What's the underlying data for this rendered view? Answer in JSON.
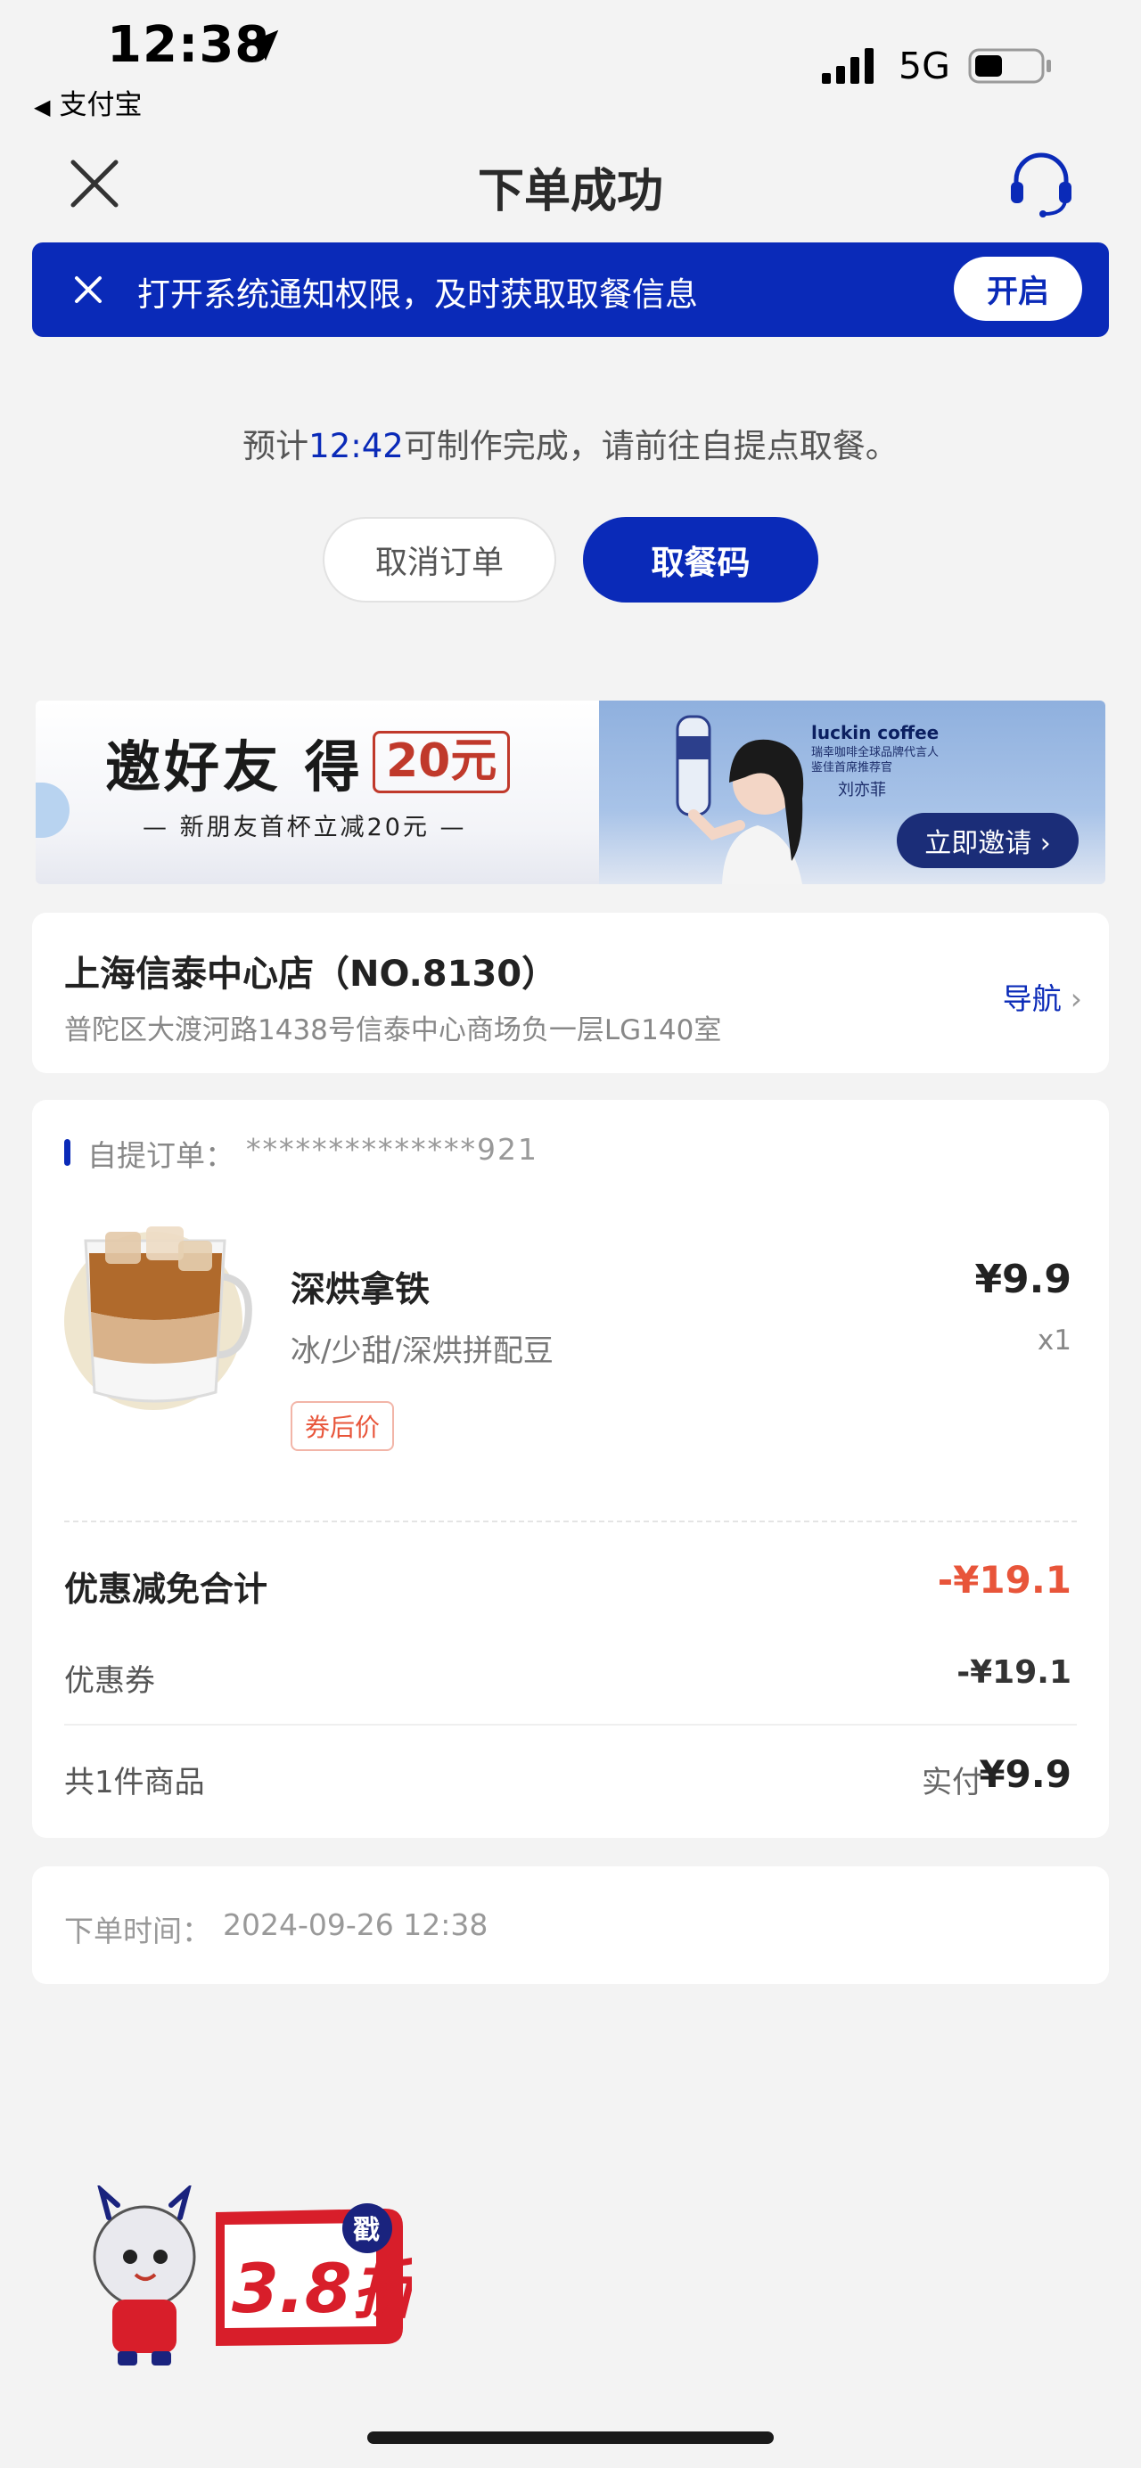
{
  "status_bar": {
    "time": "12:38",
    "back_app": "支付宝",
    "network": "5G"
  },
  "header": {
    "title": "下单成功"
  },
  "notice": {
    "text": "打开系统通知权限，及时获取取餐信息",
    "button": "开启"
  },
  "eta": {
    "prefix": "预计",
    "time": "12:42",
    "suffix": "可制作完成，请前往自提点取餐。"
  },
  "actions": {
    "cancel": "取消订单",
    "pickup": "取餐码"
  },
  "promo": {
    "title": "邀好友 得",
    "amount": "20元",
    "subtitle": "— 新朋友首杯立减20元 —",
    "brand": "luckin coffee",
    "brand_sub": "瑞幸咖啡全球品牌代言人 鉴佳首席推荐官",
    "brand_name": "刘亦菲",
    "button": "立即邀请 ›"
  },
  "store": {
    "name": "上海信泰中心店（NO.8130）",
    "address": "普陀区大渡河路1438号信泰中心商场负一层LG140室",
    "nav": "导航"
  },
  "order": {
    "label": "自提订单：",
    "number": "**************921",
    "item": {
      "name": "深烘拿铁",
      "spec": "冰/少甜/深烘拼配豆",
      "tag": "券后价",
      "price": "¥9.9",
      "qty": "x1"
    },
    "discount_total_label": "优惠减免合计",
    "discount_total": "-¥19.1",
    "coupon_label": "优惠券",
    "coupon_value": "-¥19.1",
    "count_label": "共1件商品",
    "paid_label": "实付",
    "paid": "¥9.9"
  },
  "order_time": {
    "label": "下单时间：",
    "value": "2024-09-26 12:38"
  },
  "float_badge": {
    "text": "3.8折",
    "stamp": "戳"
  },
  "colors": {
    "brand": "#0a2ab8",
    "accent_red": "#e8553a",
    "background": "#f3f3f3"
  }
}
